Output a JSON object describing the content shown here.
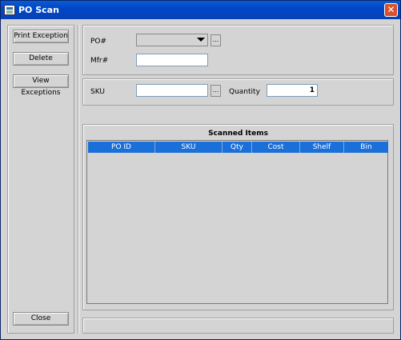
{
  "window": {
    "title": "PO Scan"
  },
  "actions": {
    "print_exception": "Print Exception",
    "delete": "Delete",
    "view_exceptions": "View Exceptions",
    "close": "Close"
  },
  "form": {
    "po_label": "PO#",
    "po_value": "",
    "mfr_label": "Mfr#",
    "mfr_value": "",
    "sku_label": "SKU",
    "sku_value": "",
    "quantity_label": "Quantity",
    "quantity_value": "1",
    "browse": "..."
  },
  "scanned": {
    "title": "Scanned Items",
    "columns": [
      "PO ID",
      "SKU",
      "Qty",
      "Cost",
      "Shelf",
      "Bin"
    ],
    "rows": []
  },
  "status": {
    "text": ""
  }
}
